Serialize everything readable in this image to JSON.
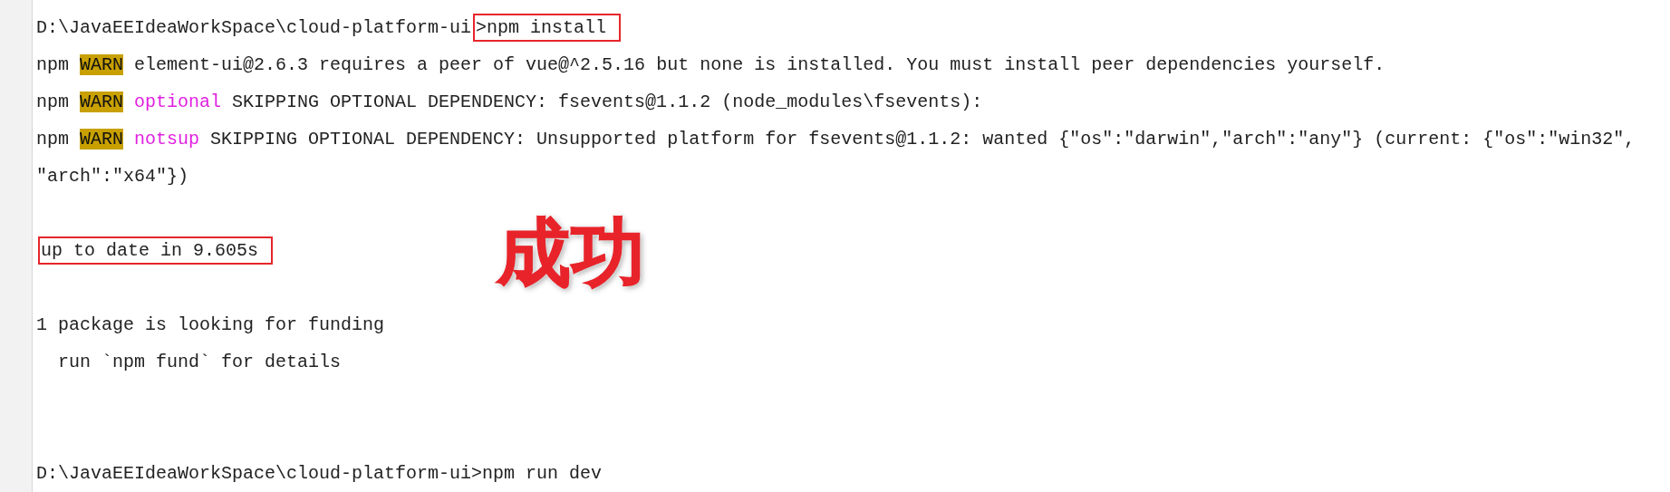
{
  "console": {
    "lines": [
      {
        "segments": [
          {
            "kind": "plain",
            "text": "D:\\JavaEEIdeaWorkSpace\\cloud-platform-ui",
            "boxed": false
          },
          {
            "kind": "plain",
            "text": ">npm install",
            "boxed": true
          }
        ]
      },
      {
        "segments": [
          {
            "kind": "plain",
            "text": "npm",
            "boxed": false
          },
          {
            "kind": "warn",
            "text": "WARN",
            "boxed": false
          },
          {
            "kind": "plain",
            "text": "element-ui@2.6.3 requires a peer of vue@^2.5.16 but none is installed. You must install peer dependencies yourself.",
            "boxed": false
          }
        ]
      },
      {
        "segments": [
          {
            "kind": "plain",
            "text": "npm",
            "boxed": false
          },
          {
            "kind": "warn",
            "text": "WARN",
            "boxed": false
          },
          {
            "kind": "keyword",
            "text": "optional",
            "boxed": false
          },
          {
            "kind": "plain",
            "text": "SKIPPING OPTIONAL DEPENDENCY: fsevents@1.1.2 (node_modules\\fsevents):",
            "boxed": false
          }
        ]
      },
      {
        "segments": [
          {
            "kind": "plain",
            "text": "npm",
            "boxed": false
          },
          {
            "kind": "warn",
            "text": "WARN",
            "boxed": false
          },
          {
            "kind": "keyword",
            "text": "notsup",
            "boxed": false
          },
          {
            "kind": "plain",
            "text": "SKIPPING OPTIONAL DEPENDENCY: Unsupported platform for fsevents@1.1.2: wanted {\"os\":\"darwin\",\"arch\":\"any\"} (current: {\"os\":\"win32\",",
            "boxed": false
          }
        ]
      },
      {
        "segments": [
          {
            "kind": "plain",
            "text": "\"arch\":\"x64\"})",
            "boxed": false
          }
        ]
      },
      {
        "kind": "blank"
      },
      {
        "segments": [
          {
            "kind": "plain",
            "text": "up to date in 9.605s",
            "boxed": true
          }
        ]
      },
      {
        "kind": "blank"
      },
      {
        "segments": [
          {
            "kind": "plain",
            "text": "1 package is looking for funding",
            "boxed": false
          }
        ]
      },
      {
        "segments": [
          {
            "kind": "plain",
            "text": "  run `npm fund` for details",
            "boxed": false
          }
        ]
      },
      {
        "kind": "blank"
      },
      {
        "kind": "blank"
      },
      {
        "segments": [
          {
            "kind": "plain",
            "text": "D:\\JavaEEIdeaWorkSpace\\cloud-platform-ui>npm run dev",
            "boxed": false
          }
        ]
      }
    ]
  },
  "annotation": {
    "text": "成功"
  }
}
